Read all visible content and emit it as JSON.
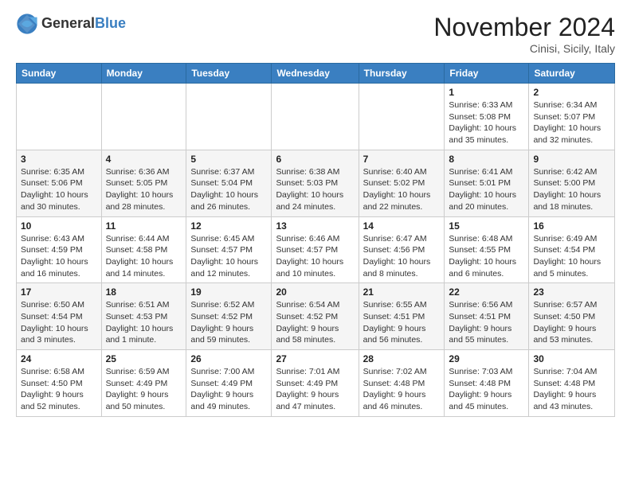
{
  "header": {
    "logo_line1": "General",
    "logo_line2": "Blue",
    "month": "November 2024",
    "location": "Cinisi, Sicily, Italy"
  },
  "days_of_week": [
    "Sunday",
    "Monday",
    "Tuesday",
    "Wednesday",
    "Thursday",
    "Friday",
    "Saturday"
  ],
  "weeks": [
    [
      {
        "day": "",
        "info": ""
      },
      {
        "day": "",
        "info": ""
      },
      {
        "day": "",
        "info": ""
      },
      {
        "day": "",
        "info": ""
      },
      {
        "day": "",
        "info": ""
      },
      {
        "day": "1",
        "info": "Sunrise: 6:33 AM\nSunset: 5:08 PM\nDaylight: 10 hours\nand 35 minutes."
      },
      {
        "day": "2",
        "info": "Sunrise: 6:34 AM\nSunset: 5:07 PM\nDaylight: 10 hours\nand 32 minutes."
      }
    ],
    [
      {
        "day": "3",
        "info": "Sunrise: 6:35 AM\nSunset: 5:06 PM\nDaylight: 10 hours\nand 30 minutes."
      },
      {
        "day": "4",
        "info": "Sunrise: 6:36 AM\nSunset: 5:05 PM\nDaylight: 10 hours\nand 28 minutes."
      },
      {
        "day": "5",
        "info": "Sunrise: 6:37 AM\nSunset: 5:04 PM\nDaylight: 10 hours\nand 26 minutes."
      },
      {
        "day": "6",
        "info": "Sunrise: 6:38 AM\nSunset: 5:03 PM\nDaylight: 10 hours\nand 24 minutes."
      },
      {
        "day": "7",
        "info": "Sunrise: 6:40 AM\nSunset: 5:02 PM\nDaylight: 10 hours\nand 22 minutes."
      },
      {
        "day": "8",
        "info": "Sunrise: 6:41 AM\nSunset: 5:01 PM\nDaylight: 10 hours\nand 20 minutes."
      },
      {
        "day": "9",
        "info": "Sunrise: 6:42 AM\nSunset: 5:00 PM\nDaylight: 10 hours\nand 18 minutes."
      }
    ],
    [
      {
        "day": "10",
        "info": "Sunrise: 6:43 AM\nSunset: 4:59 PM\nDaylight: 10 hours\nand 16 minutes."
      },
      {
        "day": "11",
        "info": "Sunrise: 6:44 AM\nSunset: 4:58 PM\nDaylight: 10 hours\nand 14 minutes."
      },
      {
        "day": "12",
        "info": "Sunrise: 6:45 AM\nSunset: 4:57 PM\nDaylight: 10 hours\nand 12 minutes."
      },
      {
        "day": "13",
        "info": "Sunrise: 6:46 AM\nSunset: 4:57 PM\nDaylight: 10 hours\nand 10 minutes."
      },
      {
        "day": "14",
        "info": "Sunrise: 6:47 AM\nSunset: 4:56 PM\nDaylight: 10 hours\nand 8 minutes."
      },
      {
        "day": "15",
        "info": "Sunrise: 6:48 AM\nSunset: 4:55 PM\nDaylight: 10 hours\nand 6 minutes."
      },
      {
        "day": "16",
        "info": "Sunrise: 6:49 AM\nSunset: 4:54 PM\nDaylight: 10 hours\nand 5 minutes."
      }
    ],
    [
      {
        "day": "17",
        "info": "Sunrise: 6:50 AM\nSunset: 4:54 PM\nDaylight: 10 hours\nand 3 minutes."
      },
      {
        "day": "18",
        "info": "Sunrise: 6:51 AM\nSunset: 4:53 PM\nDaylight: 10 hours\nand 1 minute."
      },
      {
        "day": "19",
        "info": "Sunrise: 6:52 AM\nSunset: 4:52 PM\nDaylight: 9 hours\nand 59 minutes."
      },
      {
        "day": "20",
        "info": "Sunrise: 6:54 AM\nSunset: 4:52 PM\nDaylight: 9 hours\nand 58 minutes."
      },
      {
        "day": "21",
        "info": "Sunrise: 6:55 AM\nSunset: 4:51 PM\nDaylight: 9 hours\nand 56 minutes."
      },
      {
        "day": "22",
        "info": "Sunrise: 6:56 AM\nSunset: 4:51 PM\nDaylight: 9 hours\nand 55 minutes."
      },
      {
        "day": "23",
        "info": "Sunrise: 6:57 AM\nSunset: 4:50 PM\nDaylight: 9 hours\nand 53 minutes."
      }
    ],
    [
      {
        "day": "24",
        "info": "Sunrise: 6:58 AM\nSunset: 4:50 PM\nDaylight: 9 hours\nand 52 minutes."
      },
      {
        "day": "25",
        "info": "Sunrise: 6:59 AM\nSunset: 4:49 PM\nDaylight: 9 hours\nand 50 minutes."
      },
      {
        "day": "26",
        "info": "Sunrise: 7:00 AM\nSunset: 4:49 PM\nDaylight: 9 hours\nand 49 minutes."
      },
      {
        "day": "27",
        "info": "Sunrise: 7:01 AM\nSunset: 4:49 PM\nDaylight: 9 hours\nand 47 minutes."
      },
      {
        "day": "28",
        "info": "Sunrise: 7:02 AM\nSunset: 4:48 PM\nDaylight: 9 hours\nand 46 minutes."
      },
      {
        "day": "29",
        "info": "Sunrise: 7:03 AM\nSunset: 4:48 PM\nDaylight: 9 hours\nand 45 minutes."
      },
      {
        "day": "30",
        "info": "Sunrise: 7:04 AM\nSunset: 4:48 PM\nDaylight: 9 hours\nand 43 minutes."
      }
    ]
  ]
}
